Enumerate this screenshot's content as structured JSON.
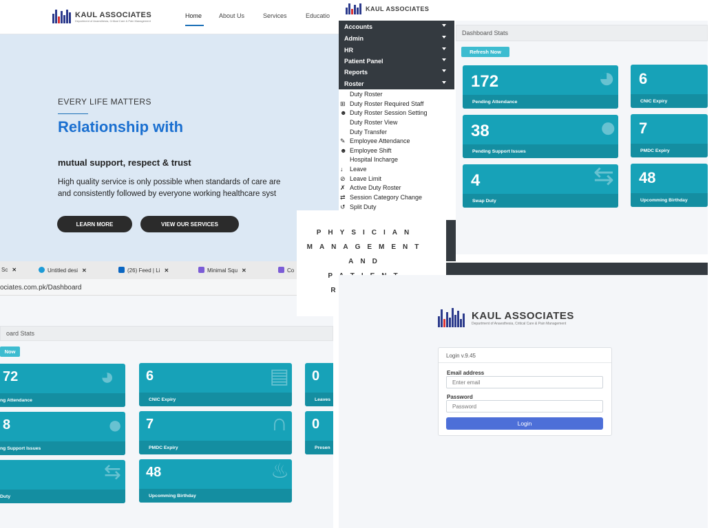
{
  "colors": {
    "teal": "#17a2b8",
    "teal_dark": "#148ea1",
    "dark": "#343a40",
    "brand_blue": "#1a6fd0",
    "login_blue": "#4d6fd8",
    "hero_bg": "#dce8f4"
  },
  "site": {
    "logo_text": "KAUL ASSOCIATES",
    "logo_sub": "Department of Anaesthesia, Critical Care & Pain Management",
    "nav": [
      "Home",
      "About Us",
      "Services",
      "Educatio"
    ],
    "hero": {
      "eyebrow": "EVERY LIFE MATTERS",
      "title": "Relationship with",
      "subtitle": "mutual support, respect & trust",
      "body_line1": "High quality service is only possible when standards of care are",
      "body_line2": "and consistently followed by everyone working healthcare syst",
      "btn_learn": "LEARN MORE",
      "btn_services": "VIEW OUR SERVICES"
    }
  },
  "browser": {
    "tabs": [
      {
        "label": "Sc",
        "icon": "page-icon",
        "color": "#9aa0a6"
      },
      {
        "label": "Untitled desi",
        "icon": "canva-icon",
        "color": "#1d9bd7"
      },
      {
        "label": "(26) Feed | Li",
        "icon": "linkedin-icon",
        "color": "#0a66c2"
      },
      {
        "label": "Minimal Squ",
        "icon": "chat-icon",
        "color": "#7b5cd6"
      },
      {
        "label": "Co",
        "icon": "chat-icon",
        "color": "#7b5cd6"
      }
    ],
    "url": "ociates.com.pk/Dashboard"
  },
  "dash_left": {
    "stats_title": "oard Stats",
    "refresh": "Now",
    "cards": [
      {
        "value": "72",
        "label": "ng Attendance",
        "icon": "clock-icon"
      },
      {
        "value": "6",
        "label": "CNIC Expiry",
        "icon": "id-card-icon"
      },
      {
        "value": "0",
        "label": "Leaves",
        "icon": ""
      },
      {
        "value": "8",
        "label": "ng Support Issues",
        "icon": "comments-icon"
      },
      {
        "value": "7",
        "label": "PMDC Expiry",
        "icon": "stethoscope-icon"
      },
      {
        "value": "0",
        "label": "Presen",
        "icon": ""
      },
      {
        "value": "",
        "label": "Duty",
        "icon": "swap-icon"
      },
      {
        "value": "48",
        "label": "Upcomming Birthday",
        "icon": "cake-icon"
      }
    ]
  },
  "dash_right": {
    "logo_text": "KAUL ASSOCIATES",
    "menu": [
      "Accounts",
      "Admin",
      "HR",
      "Patient Panel",
      "Reports",
      "Roster"
    ],
    "submenu": [
      {
        "label": "Duty Roster",
        "icon": ""
      },
      {
        "label": "Duty Roster Required Staff",
        "icon": "plus-square-icon"
      },
      {
        "label": "Duty Roster Session Setting",
        "icon": "user-cog-icon"
      },
      {
        "label": "Duty Roster View",
        "icon": ""
      },
      {
        "label": "Duty Transfer",
        "icon": ""
      },
      {
        "label": "Employee Attendance",
        "icon": "pen-icon"
      },
      {
        "label": "Employee Shift",
        "icon": "user-cog-icon"
      },
      {
        "label": "Hospital Incharge",
        "icon": ""
      },
      {
        "label": "Leave",
        "icon": "arrow-down-icon"
      },
      {
        "label": "Leave Limit",
        "icon": "ban-icon"
      },
      {
        "label": "Active Duty Roster",
        "icon": "running-icon"
      },
      {
        "label": "Session Category Change",
        "icon": "exchange-icon"
      },
      {
        "label": "Split Duty",
        "icon": "undo-icon"
      }
    ],
    "stats_title": "Dashboard Stats",
    "refresh": "Refresh Now",
    "cards": [
      {
        "value": "172",
        "label": "Pending Attendance",
        "icon": "clock-icon"
      },
      {
        "value": "6",
        "label": "CNIC Expiry",
        "icon": ""
      },
      {
        "value": "38",
        "label": "Pending Support Issues",
        "icon": "comments-icon"
      },
      {
        "value": "7",
        "label": "PMDC Expiry",
        "icon": ""
      },
      {
        "value": "4",
        "label": "Swap Duty",
        "icon": "swap-icon"
      },
      {
        "value": "48",
        "label": "Upcomming Birthday",
        "icon": ""
      }
    ]
  },
  "physician": [
    "PHYSICIAN",
    "MANAGEMENT",
    "AND",
    "PATIENT",
    "RECORD"
  ],
  "login": {
    "logo_text": "KAUL ASSOCIATES",
    "logo_sub": "Department of Anaesthesia, Critical Care & Pain Management",
    "version": "Login v.9.45",
    "email_label": "Email address",
    "email_placeholder": "Enter email",
    "password_label": "Password",
    "password_placeholder": "Password",
    "button": "Login"
  }
}
